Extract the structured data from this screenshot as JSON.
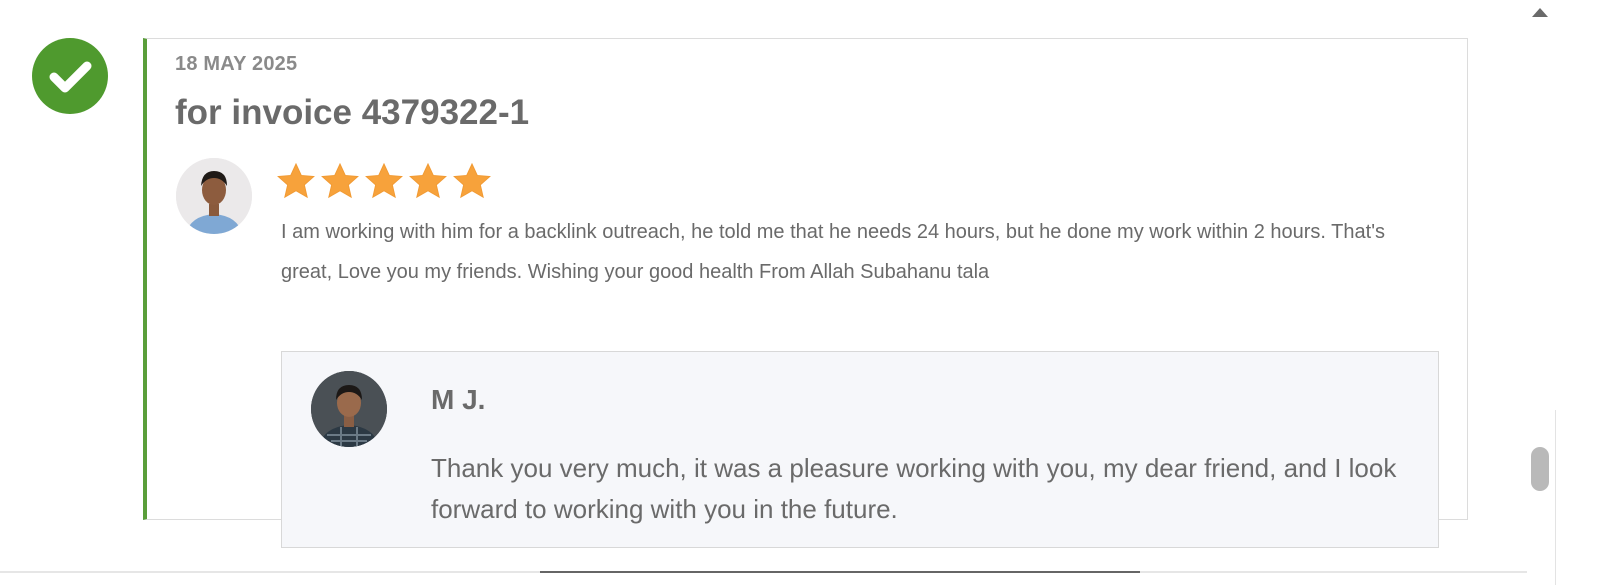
{
  "review": {
    "date": "18 MAY 2025",
    "title": "for invoice 4379322-1",
    "rating": 5,
    "text": "I am working with him for a backlink outreach, he told me that he needs 24 hours, but he done my work within 2 hours. That's great, Love you my friends. Wishing your good health From Allah Subahanu tala"
  },
  "reply": {
    "name": "M J.",
    "text": "Thank you very much, it was a pleasure working with you, my dear friend, and I look forward to working with you in the future."
  },
  "colors": {
    "accent_green": "#4f9a2e",
    "star": "#f7a23b",
    "text": "#6a6a6a"
  },
  "icons": {
    "status": "check-circle-icon",
    "star": "star-icon",
    "scroll": "arrow-up-icon"
  }
}
